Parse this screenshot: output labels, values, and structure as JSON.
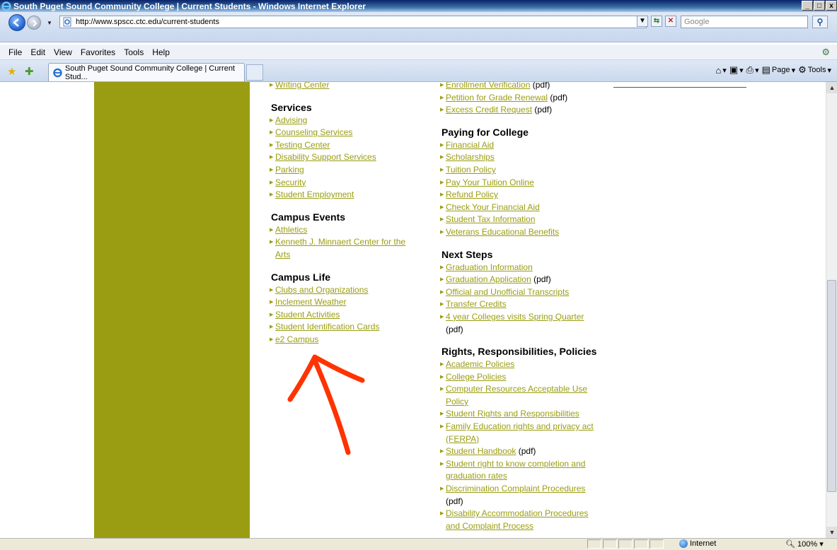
{
  "window": {
    "title": "South Puget Sound Community College | Current Students - Windows Internet Explorer",
    "btn_min": "_",
    "btn_max": "□",
    "btn_close": "x"
  },
  "address": {
    "url": "http://www.spscc.ctc.edu/current-students",
    "search_placeholder": "Google"
  },
  "menu": {
    "items": [
      "File",
      "Edit",
      "View",
      "Favorites",
      "Tools",
      "Help"
    ]
  },
  "tab": {
    "label": "South Puget Sound Community College | Current Stud..."
  },
  "commands": {
    "page": "Page",
    "tools": "Tools"
  },
  "col1": [
    {
      "heading": "",
      "links": [
        {
          "text": "Writing Center",
          "suffix": ""
        }
      ]
    },
    {
      "heading": "Services",
      "links": [
        {
          "text": "Advising",
          "suffix": ""
        },
        {
          "text": "Counseling Services",
          "suffix": ""
        },
        {
          "text": "Testing Center",
          "suffix": ""
        },
        {
          "text": "Disability Support Services",
          "suffix": ""
        },
        {
          "text": "Parking",
          "suffix": ""
        },
        {
          "text": "Security",
          "suffix": ""
        },
        {
          "text": "Student Employment",
          "suffix": ""
        }
      ]
    },
    {
      "heading": "Campus Events",
      "links": [
        {
          "text": "Athletics",
          "suffix": ""
        },
        {
          "text": "Kenneth J. Minnaert Center for the Arts",
          "suffix": ""
        }
      ]
    },
    {
      "heading": "Campus Life",
      "links": [
        {
          "text": "Clubs and Organizations",
          "suffix": ""
        },
        {
          "text": "Inclement Weather",
          "suffix": ""
        },
        {
          "text": "Student Activities",
          "suffix": ""
        },
        {
          "text": "Student Identification Cards",
          "suffix": ""
        },
        {
          "text": "e2 Campus",
          "suffix": ""
        }
      ]
    }
  ],
  "col2": [
    {
      "heading": "",
      "links": [
        {
          "text": "Enrollment Verification",
          "suffix": " (pdf)"
        },
        {
          "text": "Petition for Grade Renewal",
          "suffix": " (pdf)"
        },
        {
          "text": "Excess Credit Request",
          "suffix": " (pdf)"
        }
      ]
    },
    {
      "heading": "Paying for College",
      "links": [
        {
          "text": "Financial Aid",
          "suffix": ""
        },
        {
          "text": "Scholarships",
          "suffix": ""
        },
        {
          "text": "Tuition Policy",
          "suffix": ""
        },
        {
          "text": "Pay Your Tuition Online",
          "suffix": ""
        },
        {
          "text": "Refund Policy",
          "suffix": ""
        },
        {
          "text": "Check Your Financial Aid",
          "suffix": ""
        },
        {
          "text": "Student Tax Information",
          "suffix": ""
        },
        {
          "text": "Veterans Educational Benefits",
          "suffix": ""
        }
      ]
    },
    {
      "heading": "Next Steps",
      "links": [
        {
          "text": "Graduation Information",
          "suffix": ""
        },
        {
          "text": "Graduation Application",
          "suffix": " (pdf)"
        },
        {
          "text": "Official and Unofficial Transcripts",
          "suffix": ""
        },
        {
          "text": "Transfer Credits",
          "suffix": ""
        },
        {
          "text": "4 year Colleges visits Spring Quarter",
          "suffix": " (pdf)"
        }
      ]
    },
    {
      "heading": "Rights, Responsibilities, Policies",
      "links": [
        {
          "text": "Academic Policies",
          "suffix": ""
        },
        {
          "text": "College Policies",
          "suffix": ""
        },
        {
          "text": "Computer Resources Acceptable Use Policy",
          "suffix": ""
        },
        {
          "text": "Student Rights and Responsibilities",
          "suffix": ""
        },
        {
          "text": "Family Education rights and privacy act (FERPA)",
          "suffix": ""
        },
        {
          "text": "Student Handbook",
          "suffix": " (pdf)"
        },
        {
          "text": "Student right to know completion and graduation rates",
          "suffix": ""
        },
        {
          "text": "Discrimination Complaint Procedures",
          "suffix": " (pdf)"
        },
        {
          "text": "Disability Accommodation Procedures and Complaint Process",
          "suffix": ""
        }
      ]
    }
  ],
  "status": {
    "zone": "Internet",
    "zoom": "100%"
  },
  "colors": {
    "link": "#9a9d12",
    "sidebar": "#9a9d12",
    "annotation_arrow": "#ff3300"
  }
}
